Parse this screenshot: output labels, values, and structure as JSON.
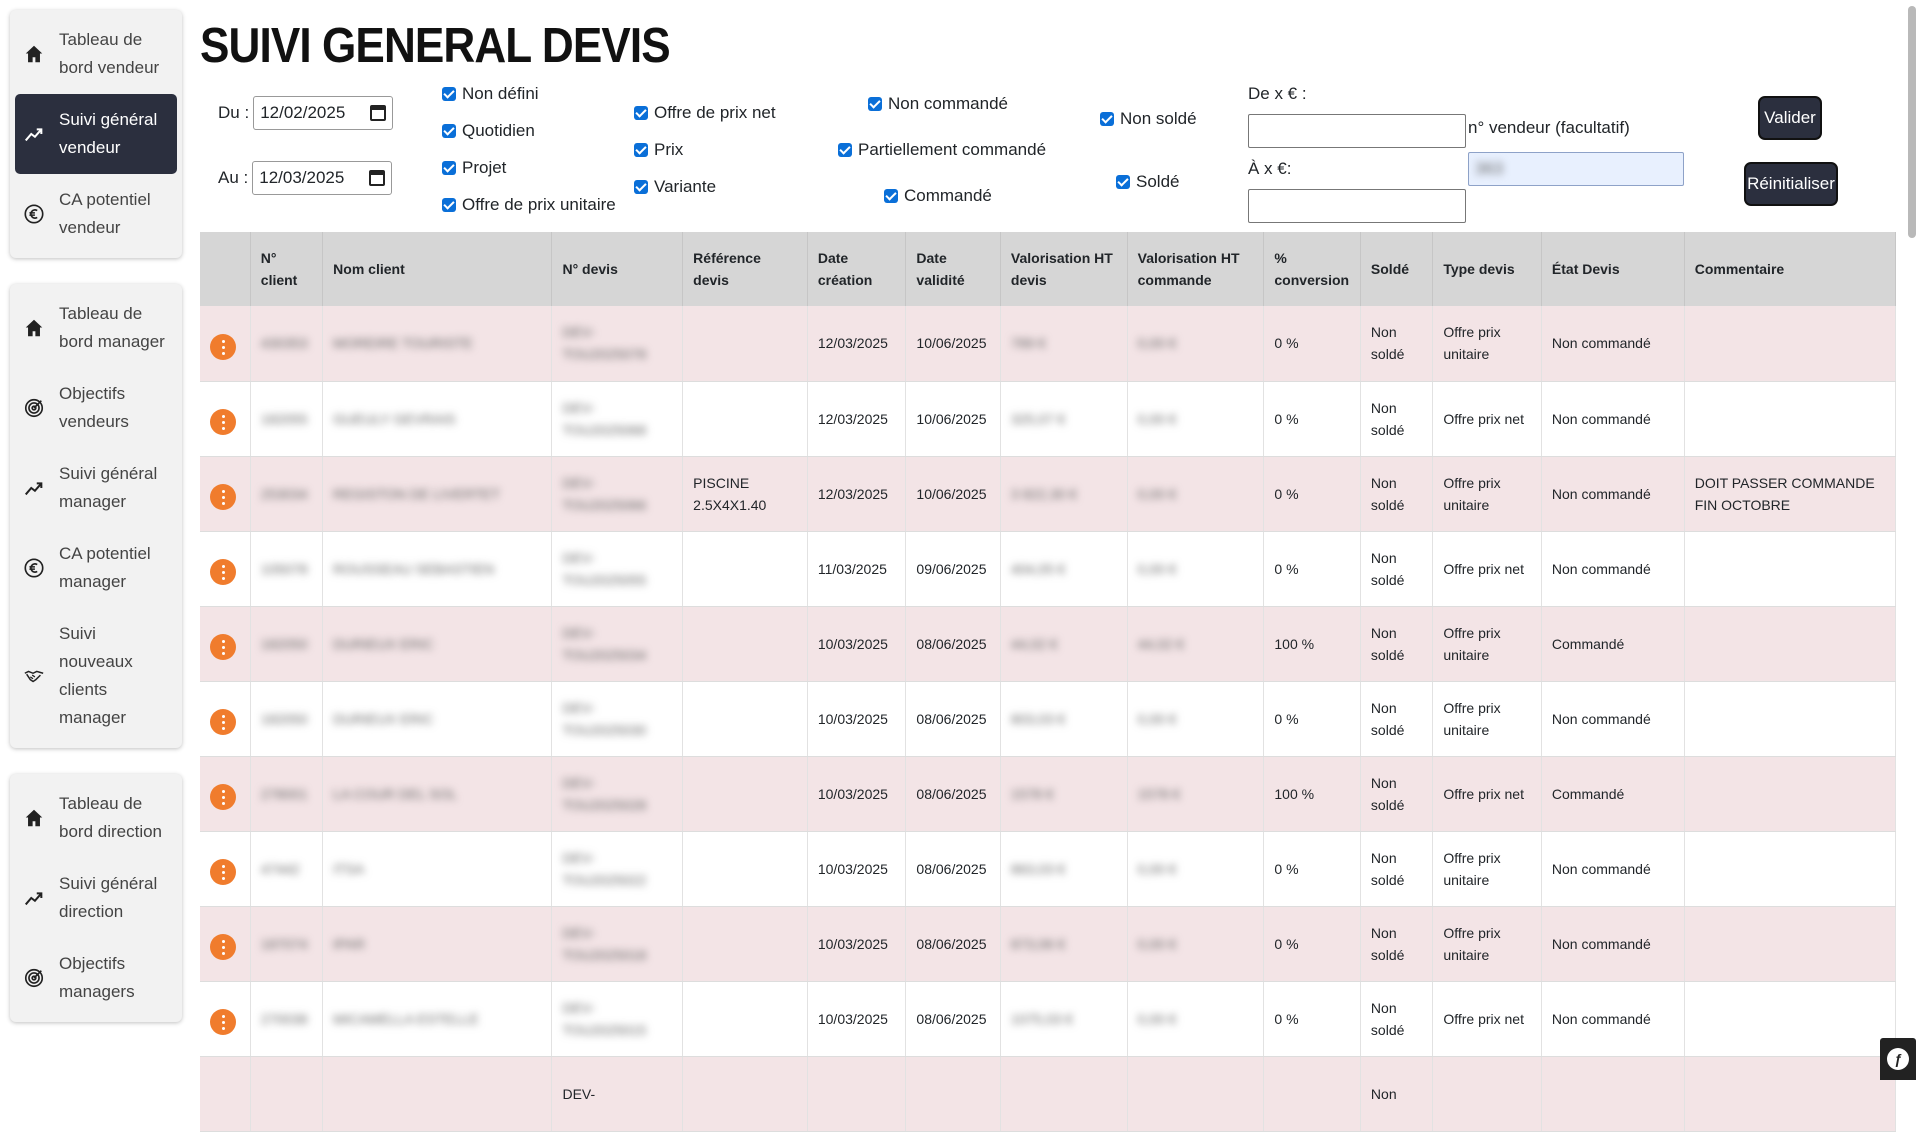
{
  "sidebar": {
    "group1": [
      {
        "label": "Tableau de bord vendeur",
        "icon": "home-icon"
      },
      {
        "label": "Suivi général vendeur",
        "icon": "trend-icon",
        "active": true
      },
      {
        "label": "CA potentiel vendeur",
        "icon": "euro-icon"
      }
    ],
    "group2": [
      {
        "label": "Tableau de bord manager",
        "icon": "home-icon"
      },
      {
        "label": "Objectifs vendeurs",
        "icon": "target-icon"
      },
      {
        "label": "Suivi général manager",
        "icon": "trend-icon"
      },
      {
        "label": "CA potentiel manager",
        "icon": "euro-icon"
      },
      {
        "label": "Suivi nouveaux clients manager",
        "icon": "handshake-icon"
      }
    ],
    "group3": [
      {
        "label": "Tableau de bord direction",
        "icon": "home-icon"
      },
      {
        "label": "Suivi général direction",
        "icon": "trend-icon"
      },
      {
        "label": "Objectifs managers",
        "icon": "target-icon"
      }
    ]
  },
  "page_title": "SUIVI GENERAL DEVIS",
  "filters": {
    "du_label": "Du :",
    "du_value": "12/02/2025",
    "au_label": "Au :",
    "au_value": "12/03/2025",
    "type": [
      "Non défini",
      "Quotidien",
      "Projet",
      "Offre de prix unitaire"
    ],
    "offre": [
      "Offre de prix net",
      "Prix",
      "Variante"
    ],
    "commande": [
      "Non commandé",
      "Partiellement commandé",
      "Commandé"
    ],
    "solde": [
      "Non soldé",
      "Soldé"
    ],
    "de_label": "De x € :",
    "a_label": "À x €:",
    "vendeur_label": "n° vendeur (facultatif)",
    "vendeur_value": "363",
    "valider": "Valider",
    "reinit": "Réinitialiser"
  },
  "table": {
    "headers": [
      "",
      "N° client",
      "Nom client",
      "N° devis",
      "Référence devis",
      "Date création",
      "Date validité",
      "Valorisation HT devis",
      "Valorisation HT commande",
      "% conversion",
      "Soldé",
      "Type devis",
      "État Devis",
      "Commentaire"
    ],
    "rows": [
      [
        "",
        "430353",
        "MOREIRE TOURISTE",
        "DEV-TOU2025078",
        "",
        "12/03/2025",
        "10/06/2025",
        "789 €",
        "0,00 €",
        "0 %",
        "Non soldé",
        "Offre prix unitaire",
        "Non commandé",
        ""
      ],
      [
        "",
        "182055",
        "GUEULY GEVRAIS",
        "DEV-TOU2025068",
        "",
        "12/03/2025",
        "10/06/2025",
        "325,07 €",
        "0,00 €",
        "0 %",
        "Non soldé",
        "Offre prix net",
        "Non commandé",
        ""
      ],
      [
        "",
        "253034",
        "REGISTON DE LIVERTET",
        "DEV-TOU2025066",
        "PISCINE 2.5X4X1.40",
        "12/03/2025",
        "10/06/2025",
        "3 822,30 €",
        "0,00 €",
        "0 %",
        "Non soldé",
        "Offre prix unitaire",
        "Non commandé",
        "DOIT PASSER COMMANDE FIN OCTOBRE"
      ],
      [
        "",
        "105078",
        "ROUSSEAU SEBASTIEN",
        "DEV-TOU2025055",
        "",
        "11/03/2025",
        "09/06/2025",
        "404,05 €",
        "0,00 €",
        "0 %",
        "Non soldé",
        "Offre prix net",
        "Non commandé",
        ""
      ],
      [
        "",
        "182050",
        "DURIEUX ERIC",
        "DEV-TOU2025034",
        "",
        "10/03/2025",
        "08/06/2025",
        "44,02 €",
        "44,02 €",
        "100 %",
        "Non soldé",
        "Offre prix unitaire",
        "Commandé",
        ""
      ],
      [
        "",
        "182050",
        "DURIEUX ERIC",
        "DEV-TOU2025030",
        "",
        "10/03/2025",
        "08/06/2025",
        "803,03 €",
        "0,00 €",
        "0 %",
        "Non soldé",
        "Offre prix unitaire",
        "Non commandé",
        ""
      ],
      [
        "",
        "278001",
        "LA COUR DEL SOL",
        "DEV-TOU2025028",
        "",
        "10/03/2025",
        "08/06/2025",
        "1578 €",
        "1578 €",
        "100 %",
        "Non soldé",
        "Offre prix net",
        "Commandé",
        ""
      ],
      [
        "",
        "47442",
        "ITSA",
        "DEV-TOU2025022",
        "",
        "10/03/2025",
        "08/06/2025",
        "863,03 €",
        "0,00 €",
        "0 %",
        "Non soldé",
        "Offre prix unitaire",
        "Non commandé",
        ""
      ],
      [
        "",
        "187074",
        "IPAR",
        "DEV-TOU2025018",
        "",
        "10/03/2025",
        "08/06/2025",
        "873,06 €",
        "0,00 €",
        "0 %",
        "Non soldé",
        "Offre prix unitaire",
        "Non commandé",
        ""
      ],
      [
        "",
        "270038",
        "MICAMELLA ESTELLE",
        "DEV-TOU2025015",
        "",
        "10/03/2025",
        "08/06/2025",
        "1075,03 €",
        "0,00 €",
        "0 %",
        "Non soldé",
        "Offre prix net",
        "Non commandé",
        ""
      ],
      [
        "",
        "",
        "",
        "DEV-",
        "",
        "",
        "",
        "",
        "",
        "",
        "Non",
        "",
        "",
        ""
      ]
    ]
  }
}
